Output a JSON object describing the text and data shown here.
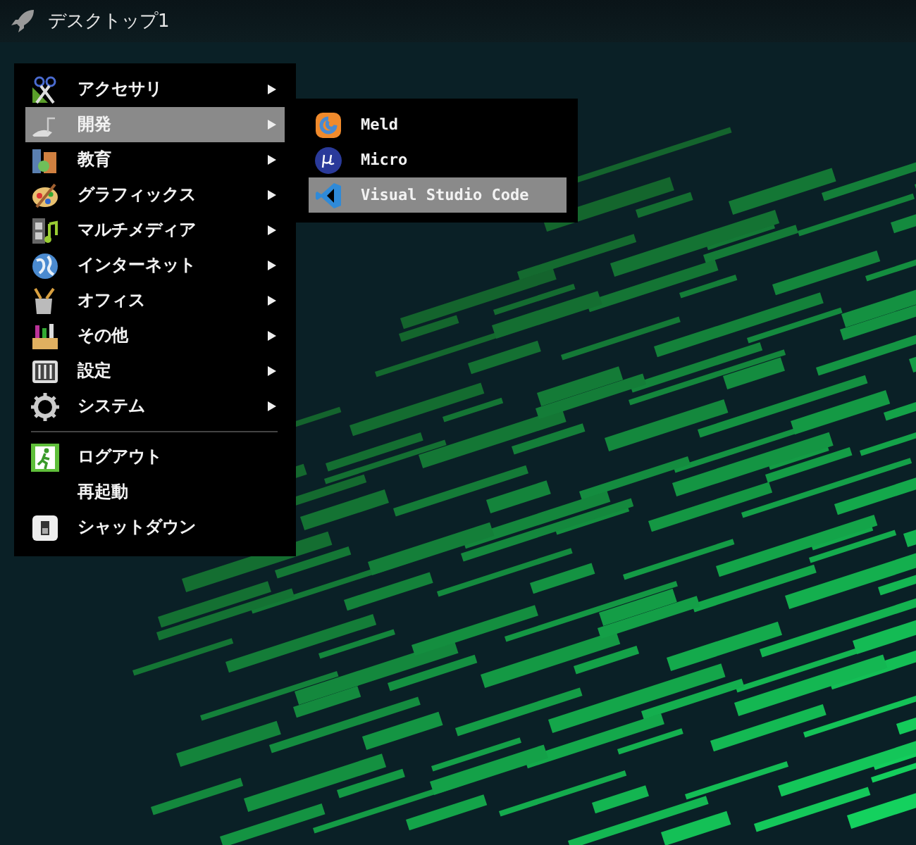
{
  "top_bar": {
    "title": "デスクトップ1"
  },
  "menu": {
    "items": [
      {
        "kind": "submenu",
        "label": "アクセサリ",
        "selected": false
      },
      {
        "kind": "submenu",
        "label": "開発",
        "selected": true
      },
      {
        "kind": "submenu",
        "label": "教育",
        "selected": false
      },
      {
        "kind": "submenu",
        "label": "グラフィックス",
        "selected": false
      },
      {
        "kind": "submenu",
        "label": "マルチメディア",
        "selected": false
      },
      {
        "kind": "submenu",
        "label": "インターネット",
        "selected": false
      },
      {
        "kind": "submenu",
        "label": "オフィス",
        "selected": false
      },
      {
        "kind": "submenu",
        "label": "その他",
        "selected": false
      },
      {
        "kind": "submenu",
        "label": "設定",
        "selected": false
      },
      {
        "kind": "submenu",
        "label": "システム",
        "selected": false
      },
      {
        "kind": "separator"
      },
      {
        "kind": "action",
        "label": "ログアウト",
        "selected": false
      },
      {
        "kind": "action",
        "label": "再起動",
        "selected": false
      },
      {
        "kind": "action",
        "label": "シャットダウン",
        "selected": false
      }
    ]
  },
  "submenu": {
    "items": [
      {
        "label": "Meld",
        "selected": false
      },
      {
        "label": "Micro",
        "selected": false
      },
      {
        "label": "Visual Studio Code",
        "selected": true
      }
    ]
  }
}
